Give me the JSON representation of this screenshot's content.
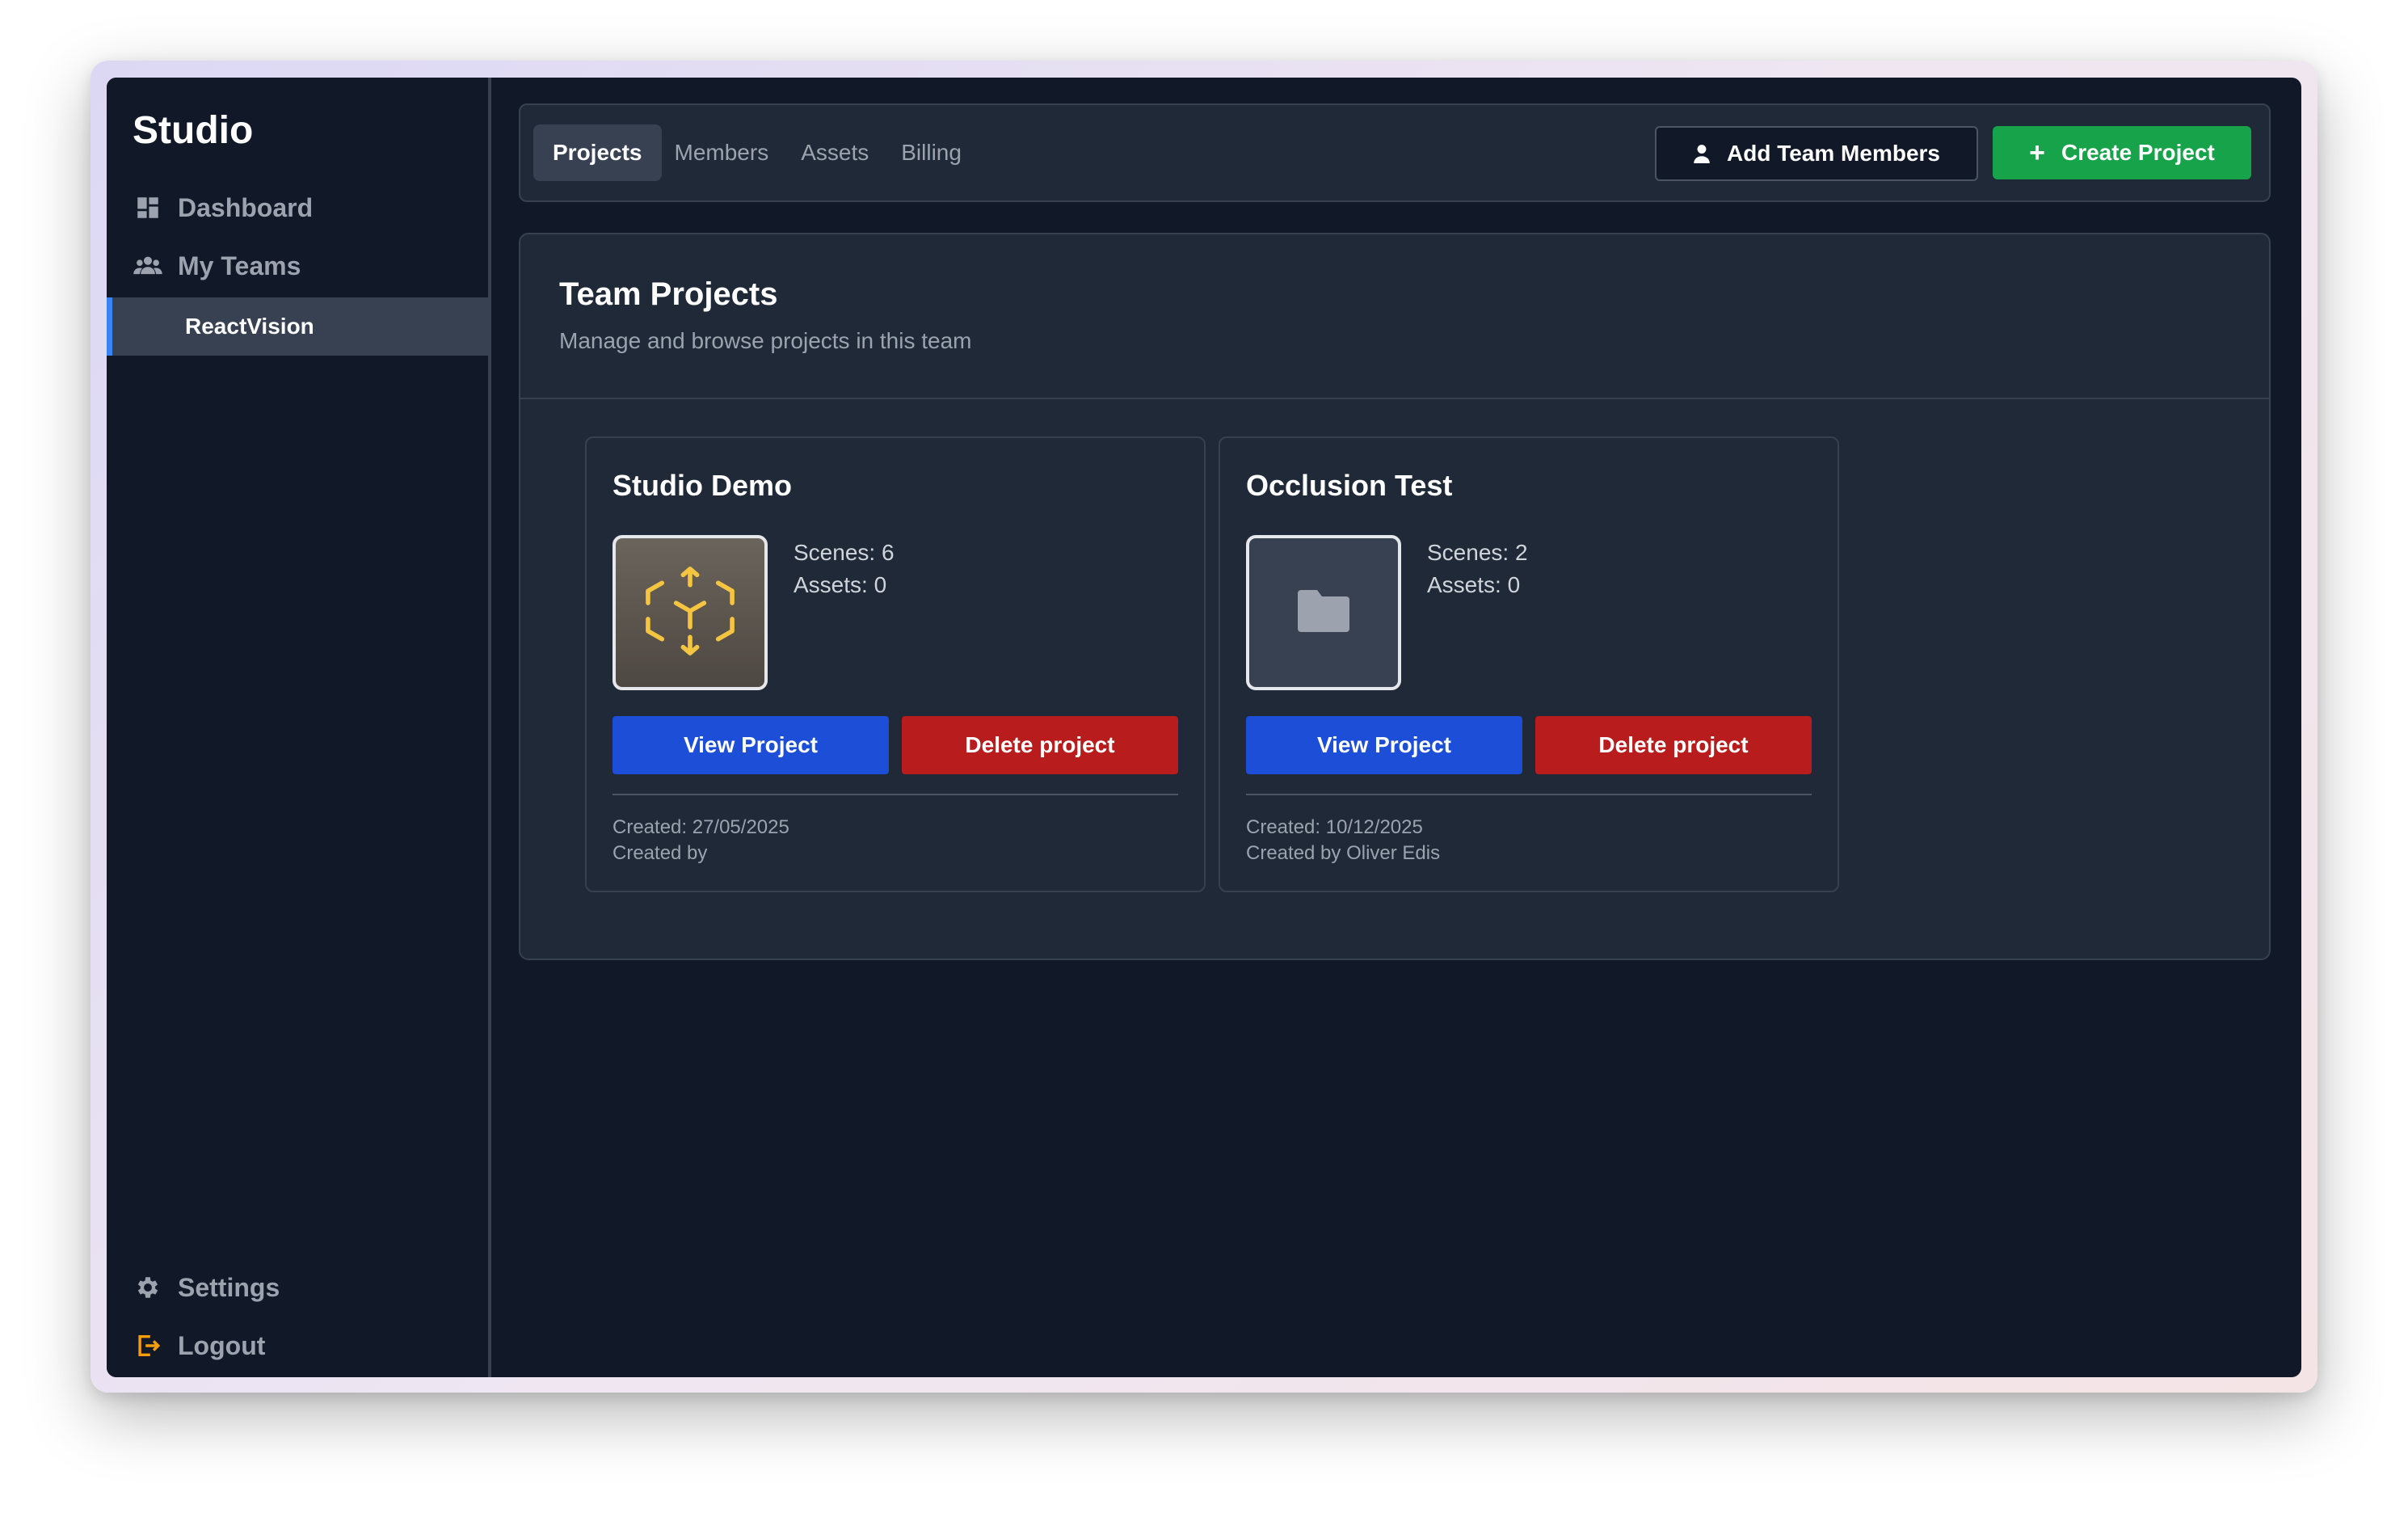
{
  "sidebar": {
    "brand": "Studio",
    "nav": {
      "dashboard": "Dashboard",
      "my_teams": "My Teams",
      "settings": "Settings",
      "logout": "Logout"
    },
    "teams": [
      {
        "label": "ReactVision",
        "active": true
      }
    ],
    "icons": {
      "dashboard": "dashboard-icon",
      "teams": "users-icon",
      "settings": "gear-icon",
      "logout": "logout-icon"
    }
  },
  "topbar": {
    "tabs": [
      {
        "label": "Projects",
        "active": true
      },
      {
        "label": "Members",
        "active": false
      },
      {
        "label": "Assets",
        "active": false
      },
      {
        "label": "Billing",
        "active": false
      }
    ],
    "add_members_label": "Add Team Members",
    "create_project_label": "Create Project",
    "create_project_symbol": "+"
  },
  "panel": {
    "title": "Team Projects",
    "subtitle": "Manage and browse projects in this team"
  },
  "projects": [
    {
      "name": "Studio Demo",
      "thumbnail": "ar-cube-icon",
      "scenes": "Scenes: 6",
      "assets": "Assets: 0",
      "view_label": "View Project",
      "delete_label": "Delete project",
      "created": "Created: 27/05/2025",
      "created_by": "Created by"
    },
    {
      "name": "Occlusion Test",
      "thumbnail": "folder-icon",
      "scenes": "Scenes: 2",
      "assets": "Assets: 0",
      "view_label": "View Project",
      "delete_label": "Delete project",
      "created": "Created: 10/12/2025",
      "created_by": "Created by Oliver Edis"
    }
  ],
  "colors": {
    "background": "#111827",
    "panel": "#1f2937",
    "accent_active": "#3b82f6",
    "primary_button": "#1d4ed8",
    "danger_button": "#b91c1c",
    "success_button": "#16a34a",
    "logout_icon": "#f59e0b",
    "ar_icon": "#f5c542"
  }
}
